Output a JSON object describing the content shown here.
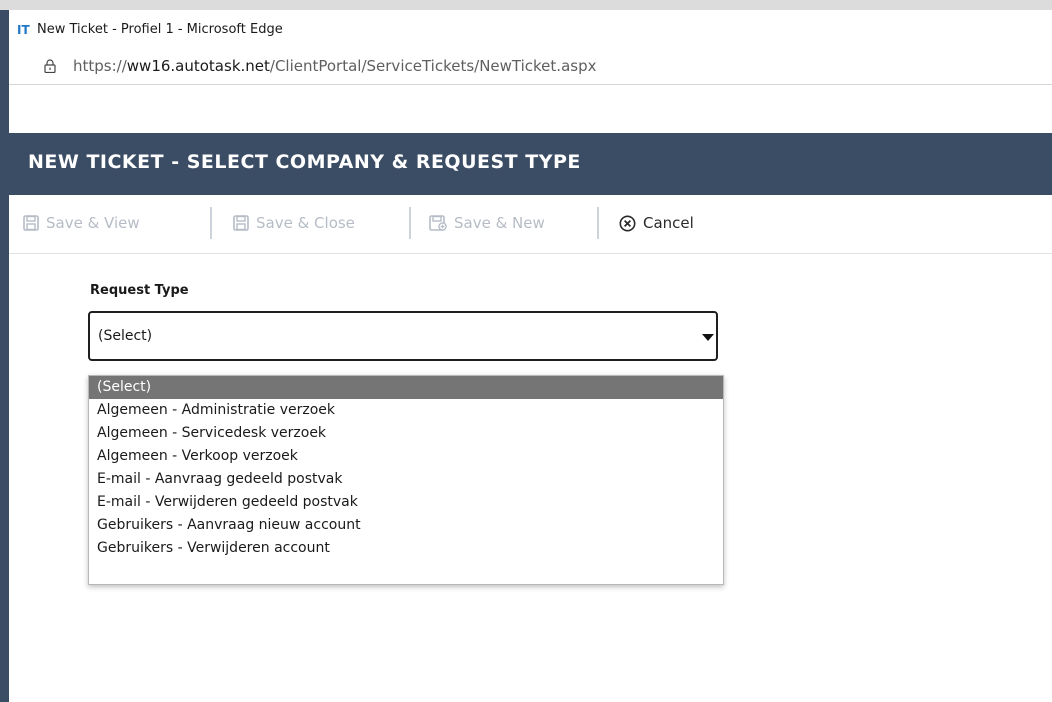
{
  "window": {
    "app_icon_text": "IT",
    "title": "New Ticket - Profiel 1 - Microsoft Edge"
  },
  "address": {
    "url_prefix": "https://",
    "url_host": "ww16.autotask.net",
    "url_path": "/ClientPortal/ServiceTickets/NewTicket.aspx"
  },
  "page": {
    "title": "NEW TICKET - SELECT COMPANY & REQUEST TYPE"
  },
  "toolbar": {
    "save_view": "Save & View",
    "save_close": "Save & Close",
    "save_new": "Save & New",
    "cancel": "Cancel"
  },
  "form": {
    "request_type_label": "Request Type",
    "request_type_value": "(Select)",
    "options": [
      "(Select)",
      "Algemeen - Administratie verzoek",
      "Algemeen - Servicedesk verzoek",
      "Algemeen - Verkoop verzoek",
      "E-mail - Aanvraag gedeeld postvak",
      "E-mail - Verwijderen gedeeld postvak",
      "Gebruikers - Aanvraag nieuw account",
      "Gebruikers - Verwijderen account"
    ],
    "selected_option_index": 0
  },
  "colors": {
    "header_bg": "#3b4d65",
    "selected_option_bg": "#757575",
    "disabled_text": "#b6bcc6"
  }
}
